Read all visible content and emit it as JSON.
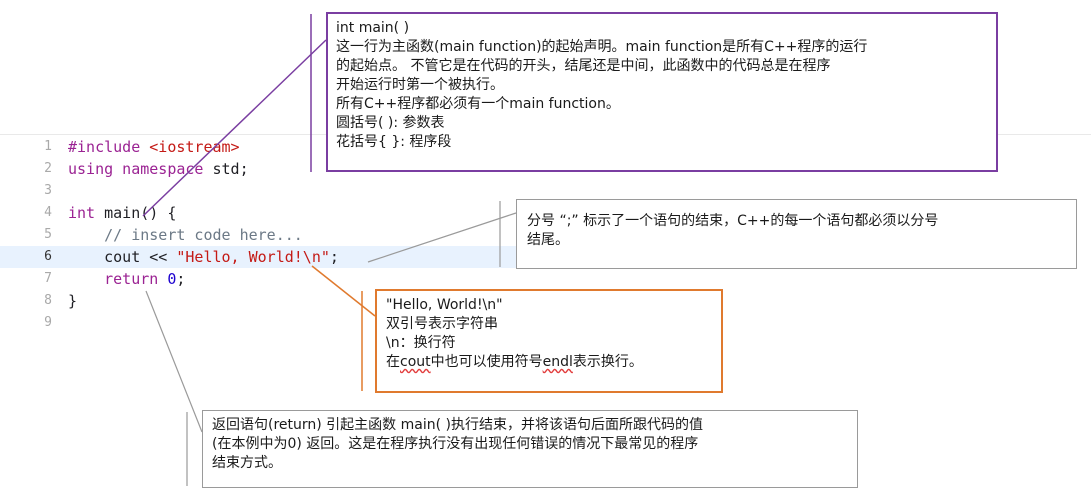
{
  "editor": {
    "lines": [
      {
        "num": "1",
        "parts": [
          {
            "t": "#include ",
            "c": "kw"
          },
          {
            "t": "<iostream>",
            "c": "str"
          }
        ]
      },
      {
        "num": "2",
        "parts": [
          {
            "t": "using namespace ",
            "c": "kw"
          },
          {
            "t": "std;",
            "c": "pl"
          }
        ]
      },
      {
        "num": "3",
        "parts": []
      },
      {
        "num": "4",
        "parts": [
          {
            "t": "int ",
            "c": "kw"
          },
          {
            "t": "main() {",
            "c": "pl"
          }
        ]
      },
      {
        "num": "5",
        "parts": [
          {
            "t": "    // insert code here...",
            "c": "cmt"
          }
        ]
      },
      {
        "num": "6",
        "current": true,
        "parts": [
          {
            "t": "    cout << ",
            "c": "pl"
          },
          {
            "t": "\"Hello, World!\\n\"",
            "c": "str"
          },
          {
            "t": ";",
            "c": "pl"
          }
        ]
      },
      {
        "num": "7",
        "parts": [
          {
            "t": "    ",
            "c": "pl"
          },
          {
            "t": "return ",
            "c": "kw"
          },
          {
            "t": "0",
            "c": "num"
          },
          {
            "t": ";",
            "c": "pl"
          }
        ]
      },
      {
        "num": "8",
        "parts": [
          {
            "t": "}",
            "c": "pl"
          }
        ]
      },
      {
        "num": "9",
        "parts": []
      }
    ]
  },
  "callouts": {
    "main": [
      "int main( )",
      "这一行为主函数(main function)的起始声明。main function是所有C++程序的运行",
      "的起始点。 不管它是在代码的开头，结尾还是中间，此函数中的代码总是在程序",
      "开始运行时第一个被执行。",
      "所有C++程序都必须有一个main function。",
      "圆括号( ): 参数表",
      "花括号{ }: 程序段"
    ],
    "semicolon": [
      "分号 “;” 标示了一个语句的结束，C++的每一个语句都必须以分号",
      "结尾。"
    ],
    "hello": {
      "line1": "\"Hello, World!\\n\"",
      "line2": "双引号表示字符串",
      "line3": "\\n：换行符",
      "line4_prefix": "在",
      "line4_cout": "cout",
      "line4_mid": "中也可以使用符号",
      "line4_endl": "endl",
      "line4_suffix": "表示换行。"
    },
    "return": [
      "返回语句(return) 引起主函数 main( )执行结束，并将该语句后面所跟代码的值",
      "(在本例中为0) 返回。这是在程序执行没有出现任何错误的情况下最常见的程序",
      "结束方式。"
    ]
  },
  "colors": {
    "keyword": "#9b2393",
    "string": "#c41a16",
    "number": "#1c00cf",
    "comment": "#6c7986",
    "current_line": "#e8f2fe",
    "main_border": "#7a3ea1",
    "hello_border": "#e07a2e",
    "neutral_border": "#9a9a9a"
  }
}
